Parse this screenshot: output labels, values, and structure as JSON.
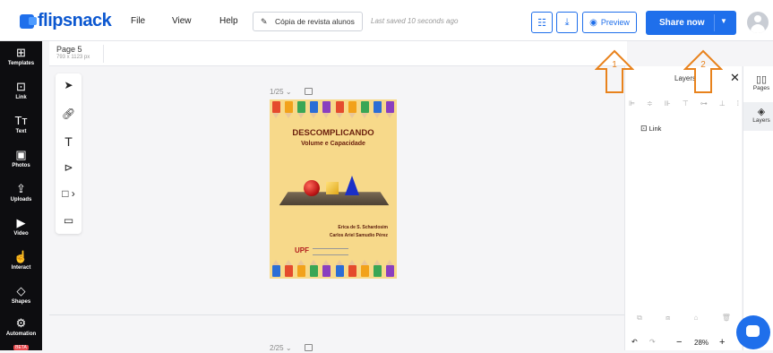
{
  "topbar": {
    "logo": "flipsnack",
    "menu": [
      "File",
      "View",
      "Help"
    ],
    "doc_name": "Cópia de revista alunos",
    "saved": "Last saved 10 seconds ago",
    "preview_label": "Preview",
    "share_label": "Share now"
  },
  "leftnav": [
    {
      "icon": "templates-icon",
      "label": "Templates"
    },
    {
      "icon": "link-icon",
      "label": "Link"
    },
    {
      "icon": "text-icon",
      "label": "Text"
    },
    {
      "icon": "photos-icon",
      "label": "Photos"
    },
    {
      "icon": "uploads-icon",
      "label": "Uploads"
    },
    {
      "icon": "video-icon",
      "label": "Video"
    },
    {
      "icon": "interact-icon",
      "label": "Interact"
    },
    {
      "icon": "shapes-icon",
      "label": "Shapes"
    },
    {
      "icon": "automation-icon",
      "label": "Automation",
      "badge": "BETA"
    }
  ],
  "page": {
    "name": "Page 5",
    "size": "793 x 1123 px"
  },
  "canvas": {
    "counter_top": "1/25",
    "counter_bottom": "2/25",
    "cover_title": "DESCOMPLICANDO",
    "cover_subtitle": "Volume e Capacidade",
    "author_1": "Erica de S. Schardosim",
    "author_2": "Carlos Ariel Samudio Pérez",
    "logo": "UPF"
  },
  "layers": {
    "title": "Layers",
    "items": [
      "Link"
    ],
    "zoom": "28%"
  },
  "rightbar": [
    "Pages",
    "Layers"
  ],
  "annotations": [
    "1",
    "2"
  ],
  "colors": {
    "brand": "#1f6feb",
    "arrow": "#e8821c",
    "nav_bg": "#0d0d10"
  }
}
